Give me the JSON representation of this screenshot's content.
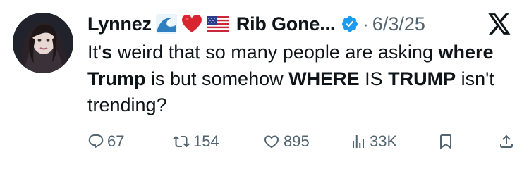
{
  "author": {
    "display_name_start": "Lynnez",
    "display_name_end": "Rib Gone...",
    "emoji_icons": [
      "ocean-wave-icon",
      "red-heart-icon",
      "us-flag-icon"
    ],
    "verified_icon": "verified-badge-icon",
    "separator": "·",
    "date": "6/3/25"
  },
  "tweet_text": [
    {
      "text": "It'",
      "bold": false
    },
    {
      "text": "s",
      "bold": true
    },
    {
      "text": " weird that so many people are asking ",
      "bold": false
    },
    {
      "text": "where Trump",
      "bold": true
    },
    {
      "text": " is but somehow ",
      "bold": false
    },
    {
      "text": "WHERE",
      "bold": true
    },
    {
      "text": " IS ",
      "bold": false
    },
    {
      "text": "TRUMP",
      "bold": true
    },
    {
      "text": " isn't trending?",
      "bold": false
    }
  ],
  "actions": {
    "replies": "67",
    "reposts": "154",
    "likes": "895",
    "views": "33K"
  },
  "colors": {
    "text": "#0f1419",
    "muted": "#536471",
    "verified": "#1d9bf0"
  },
  "brand_icon": "x-logo-icon"
}
